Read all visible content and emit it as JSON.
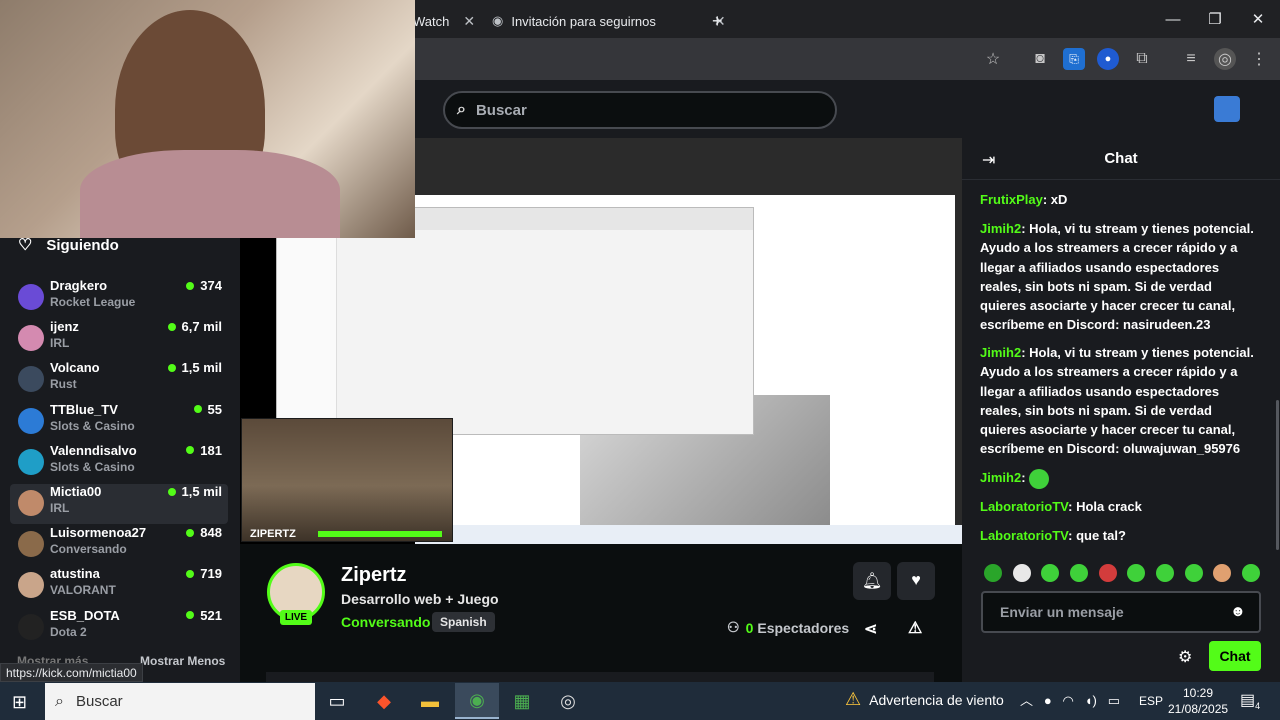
{
  "browser": {
    "tabs": [
      {
        "label": "Watch"
      },
      {
        "label": "Invitación para seguirnos"
      }
    ],
    "new_tab": "+",
    "window_controls": {
      "minimize": "—",
      "maximize": "❐",
      "close": "✕"
    }
  },
  "header": {
    "search_placeholder": "Buscar"
  },
  "sidebar": {
    "title": "Siguiendo",
    "channels": [
      {
        "name": "Dragkero",
        "category": "Rocket League",
        "viewers": "374",
        "color": "#6a4bd6"
      },
      {
        "name": "ijenz",
        "category": "IRL",
        "viewers": "6,7 mil",
        "color": "#d48ab0"
      },
      {
        "name": "Volcano",
        "category": "Rust",
        "viewers": "1,5 mil",
        "color": "#3b4a5e"
      },
      {
        "name": "TTBlue_TV",
        "category": "Slots & Casino",
        "viewers": "55",
        "color": "#2c7bd6"
      },
      {
        "name": "Valenndisalvo",
        "category": "Slots & Casino",
        "viewers": "181",
        "color": "#1f9ec7"
      },
      {
        "name": "Mictia00",
        "category": "IRL",
        "viewers": "1,5 mil",
        "color": "#c08a6a"
      },
      {
        "name": "Luisormenoa27",
        "category": "Conversando",
        "viewers": "848",
        "color": "#8a6a4a"
      },
      {
        "name": "atustina",
        "category": "VALORANT",
        "viewers": "719",
        "color": "#c9a58a"
      },
      {
        "name": "ESB_DOTA",
        "category": "Dota 2",
        "viewers": "521",
        "color": "#222222"
      }
    ],
    "show_more": "Mostrar más",
    "show_less": "Mostrar Menos",
    "url_tooltip": "https://kick.com/mictia00"
  },
  "stream": {
    "overlay_label": "ZIPERTZ",
    "live_badge": "LIVE",
    "streamer": "Zipertz",
    "title": "Desarrollo web + Juego",
    "category": "Conversando",
    "language": "Spanish",
    "viewers_count": "0",
    "viewers_label": "Espectadores"
  },
  "chat": {
    "title": "Chat",
    "messages": [
      {
        "user": "FrutixPlay",
        "text": ": xD"
      },
      {
        "user": "Jimih2",
        "text": ": Hola, vi tu stream y tienes potencial. Ayudo a los streamers a crecer rápido y a llegar a afiliados usando espectadores reales, sin bots ni spam. Si de verdad quieres asociarte y hacer crecer tu canal, escríbeme en Discord: nasirudeen.23"
      },
      {
        "user": "Jimih2",
        "text": ": Hola, vi tu stream y tienes potencial. Ayudo a los streamers a crecer rápido y a llegar a afiliados usando espectadores reales, sin bots ni spam. Si de verdad quieres asociarte y hacer crecer tu canal, escríbeme en Discord: oluwajuwan_95976"
      },
      {
        "user": "Jimih2",
        "text": ": "
      },
      {
        "user": "LaboratorioTV",
        "text": ": Hola crack"
      },
      {
        "user": "LaboratorioTV",
        "text": ": que tal?"
      }
    ],
    "emote_colors": [
      "#2aa52a",
      "#e8e8e8",
      "#3fd13a",
      "#3fd13a",
      "#d33c3c",
      "#3fd13a",
      "#3fd13a",
      "#3fd13a",
      "#e0a070",
      "#3fd13a"
    ],
    "input_placeholder": "Enviar un mensaje",
    "send_label": "Chat",
    "accent": "#53fc18"
  },
  "taskbar": {
    "search_placeholder": "Buscar",
    "weather": "Advertencia de viento",
    "language": "ESP",
    "time": "10:29",
    "date": "21/08/2025",
    "notifications": "4"
  }
}
